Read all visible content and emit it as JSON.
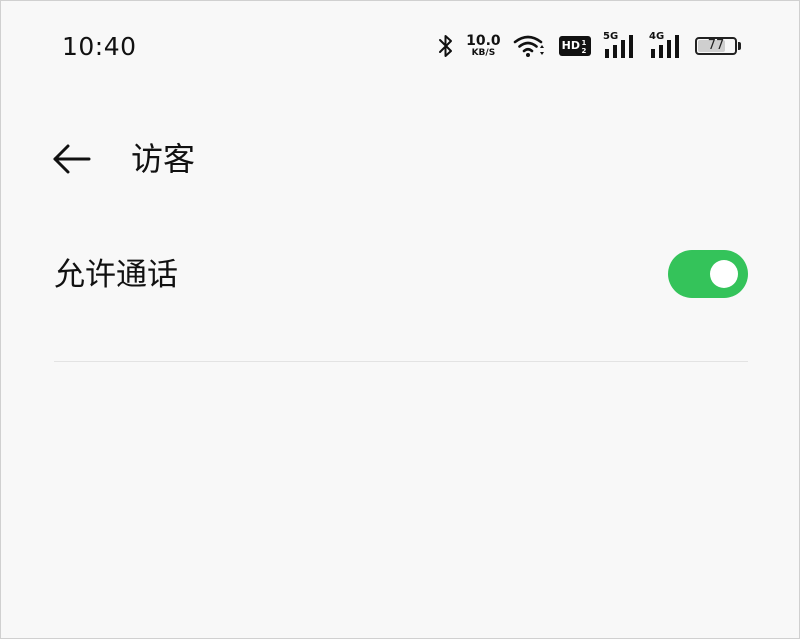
{
  "status_bar": {
    "time": "10:40",
    "net_speed_value": "10.0",
    "net_speed_unit": "KB/S",
    "hd_label": "HD",
    "sim1_network": "5G",
    "sim2_network": "4G",
    "battery_level": "77",
    "battery_fraction": 0.77
  },
  "title_bar": {
    "title": "访客"
  },
  "settings": {
    "allow_calls_label": "允许通话",
    "allow_calls_enabled": true
  },
  "colors": {
    "toggle_on": "#34c35a",
    "background": "#f8f8f8"
  }
}
